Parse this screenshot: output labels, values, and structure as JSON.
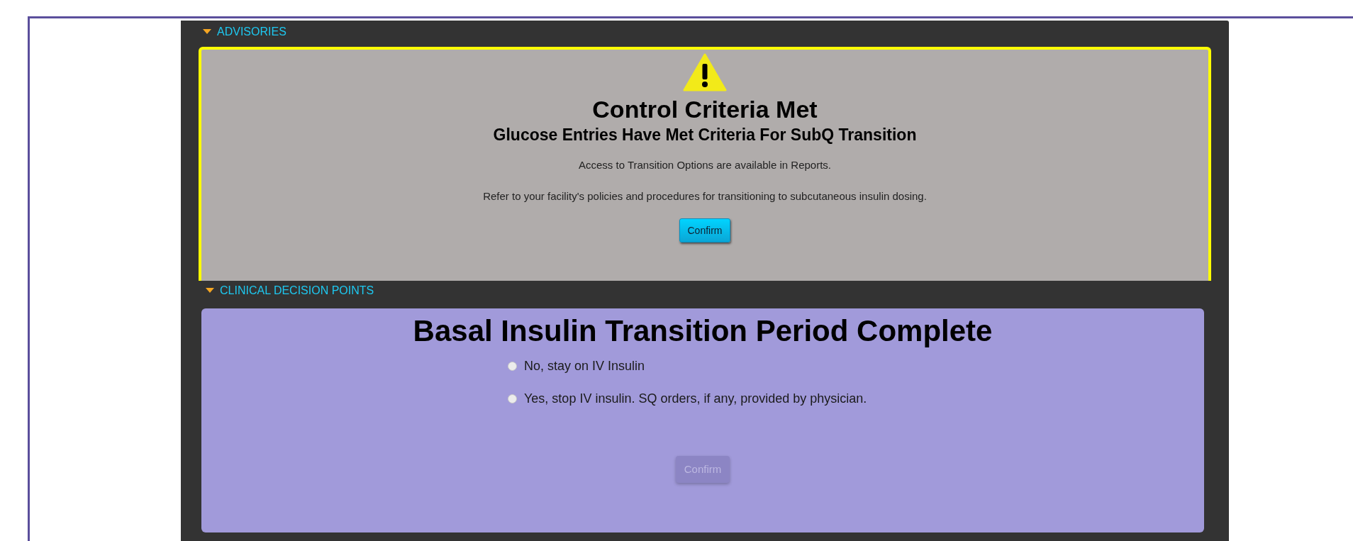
{
  "advisories": {
    "heading": "ADVISORIES",
    "expanded": true,
    "alert": {
      "title": "Control Criteria Met",
      "subtitle": "Glucose Entries Have Met Criteria For SubQ Transition",
      "messages": [
        "Access to Transition Options are available in Reports.",
        "Refer to your facility's policies and procedures for transitioning to subcutaneous insulin dosing."
      ],
      "confirm": {
        "label": "Confirm",
        "disabled": false
      }
    }
  },
  "clinical_decision_points": {
    "heading": "CLINICAL DECISION POINTS",
    "expanded": true,
    "title": "Basal Insulin Transition Period Complete",
    "options": [
      {
        "label": "No, stay on IV Insulin",
        "selected": false
      },
      {
        "label": "Yes, stop IV insulin. SQ orders, if any, provided by physician.",
        "selected": false
      }
    ],
    "confirm": {
      "label": "Confirm",
      "disabled": true
    }
  }
}
